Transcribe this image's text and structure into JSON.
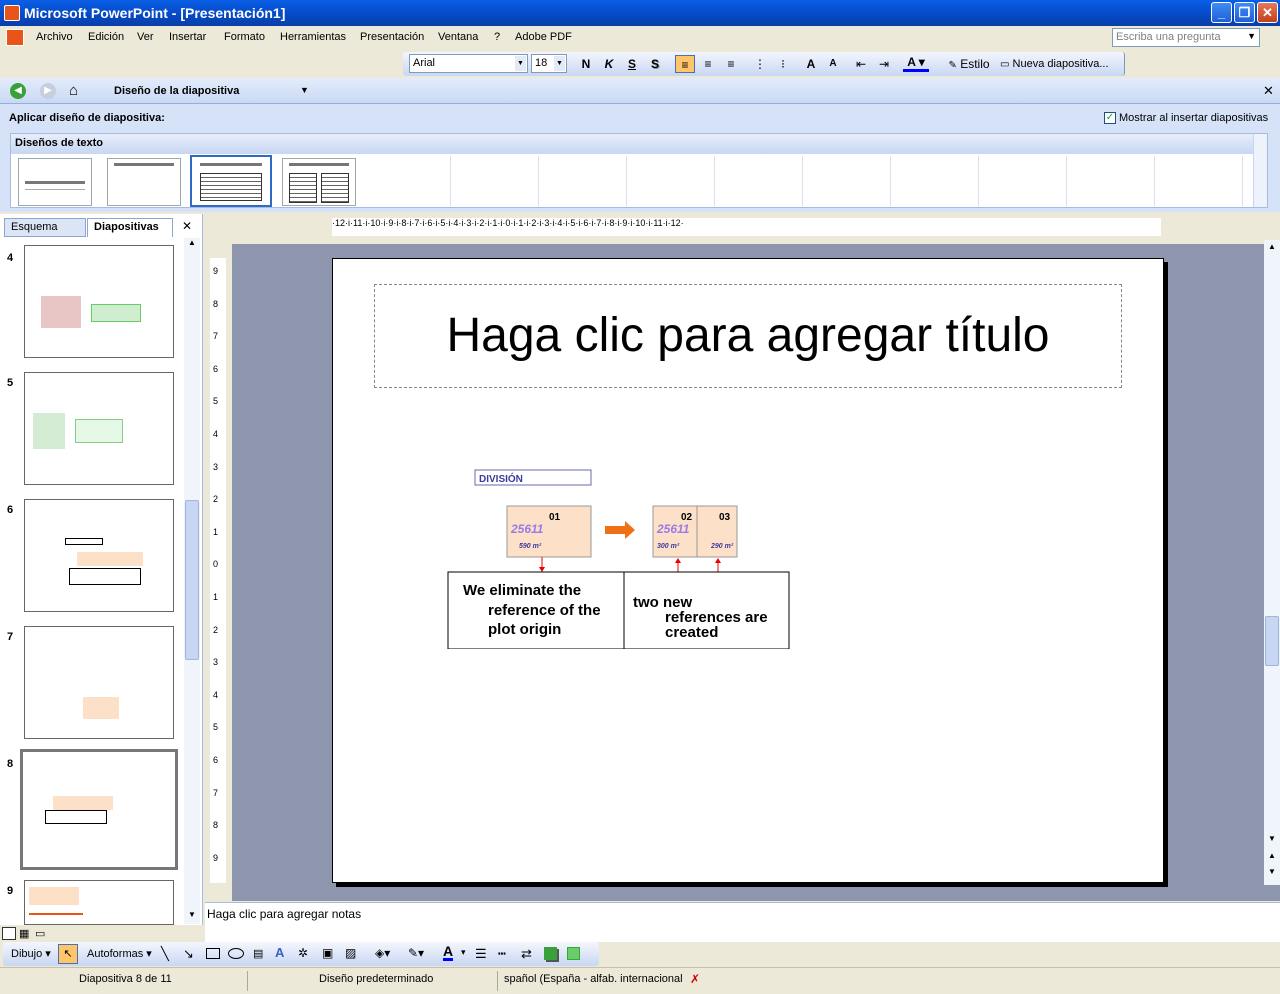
{
  "window": {
    "title": "Microsoft PowerPoint - [Presentación1]"
  },
  "menu": [
    "Archivo",
    "Edición",
    "Ver",
    "Insertar",
    "Formato",
    "Herramientas",
    "Presentación",
    "Ventana",
    "?",
    "Adobe PDF"
  ],
  "help_placeholder": "Escriba una pregunta",
  "format_toolbar": {
    "font": "Arial",
    "size": "18",
    "bold": "N",
    "italic": "K",
    "underline": "S",
    "shadow": "S",
    "estilo": "Estilo",
    "new_slide": "Nueva diapositiva..."
  },
  "task_pane": {
    "title": "Diseño de la diapositiva",
    "apply_label": "Aplicar diseño de diapositiva:",
    "show_on_insert": "Mostrar al insertar diapositivas",
    "section": "Diseños de texto"
  },
  "tabs": {
    "outline": "Esquema",
    "slides": "Diapositivas"
  },
  "slides": [
    {
      "n": "4"
    },
    {
      "n": "5"
    },
    {
      "n": "6"
    },
    {
      "n": "7"
    },
    {
      "n": "8"
    },
    {
      "n": "9"
    }
  ],
  "ruler_h": "·12·i·11·i·10·i·9·i·8·i·7·i·6·i·5·i·4·i·3·i·2·i·1·i·0·i·1·i·2·i·3·i·4·i·5·i·6·i·7·i·8·i·9·i·10·i·11·i·12·",
  "ruler_v": [
    "9",
    "8",
    "7",
    "6",
    "5",
    "4",
    "3",
    "2",
    "1",
    "0",
    "1",
    "2",
    "3",
    "4",
    "5",
    "6",
    "7",
    "8",
    "9"
  ],
  "slide": {
    "title_placeholder": "Haga clic para agregar título",
    "division": "DIVISIÓN",
    "parcel_a": {
      "id": "01",
      "ref": "25611",
      "area": "590 m²"
    },
    "parcel_b": {
      "id": "02",
      "ref": "25611",
      "area": "300 m²"
    },
    "parcel_c": {
      "id": "03",
      "area": "290 m²"
    },
    "left_text_1": "We eliminate the",
    "left_text_2": "reference of the",
    "left_text_3": "plot origin",
    "right_text_1": "two new",
    "right_text_2": "references are",
    "right_text_3": "created"
  },
  "notes_placeholder": "Haga clic para agregar notas",
  "draw_toolbar": {
    "dibujo": "Dibujo",
    "autoformas": "Autoformas"
  },
  "status": {
    "slide": "Diapositiva 8 de 11",
    "design": "Diseño predeterminado",
    "lang": "spañol (España - alfab. internacional"
  }
}
